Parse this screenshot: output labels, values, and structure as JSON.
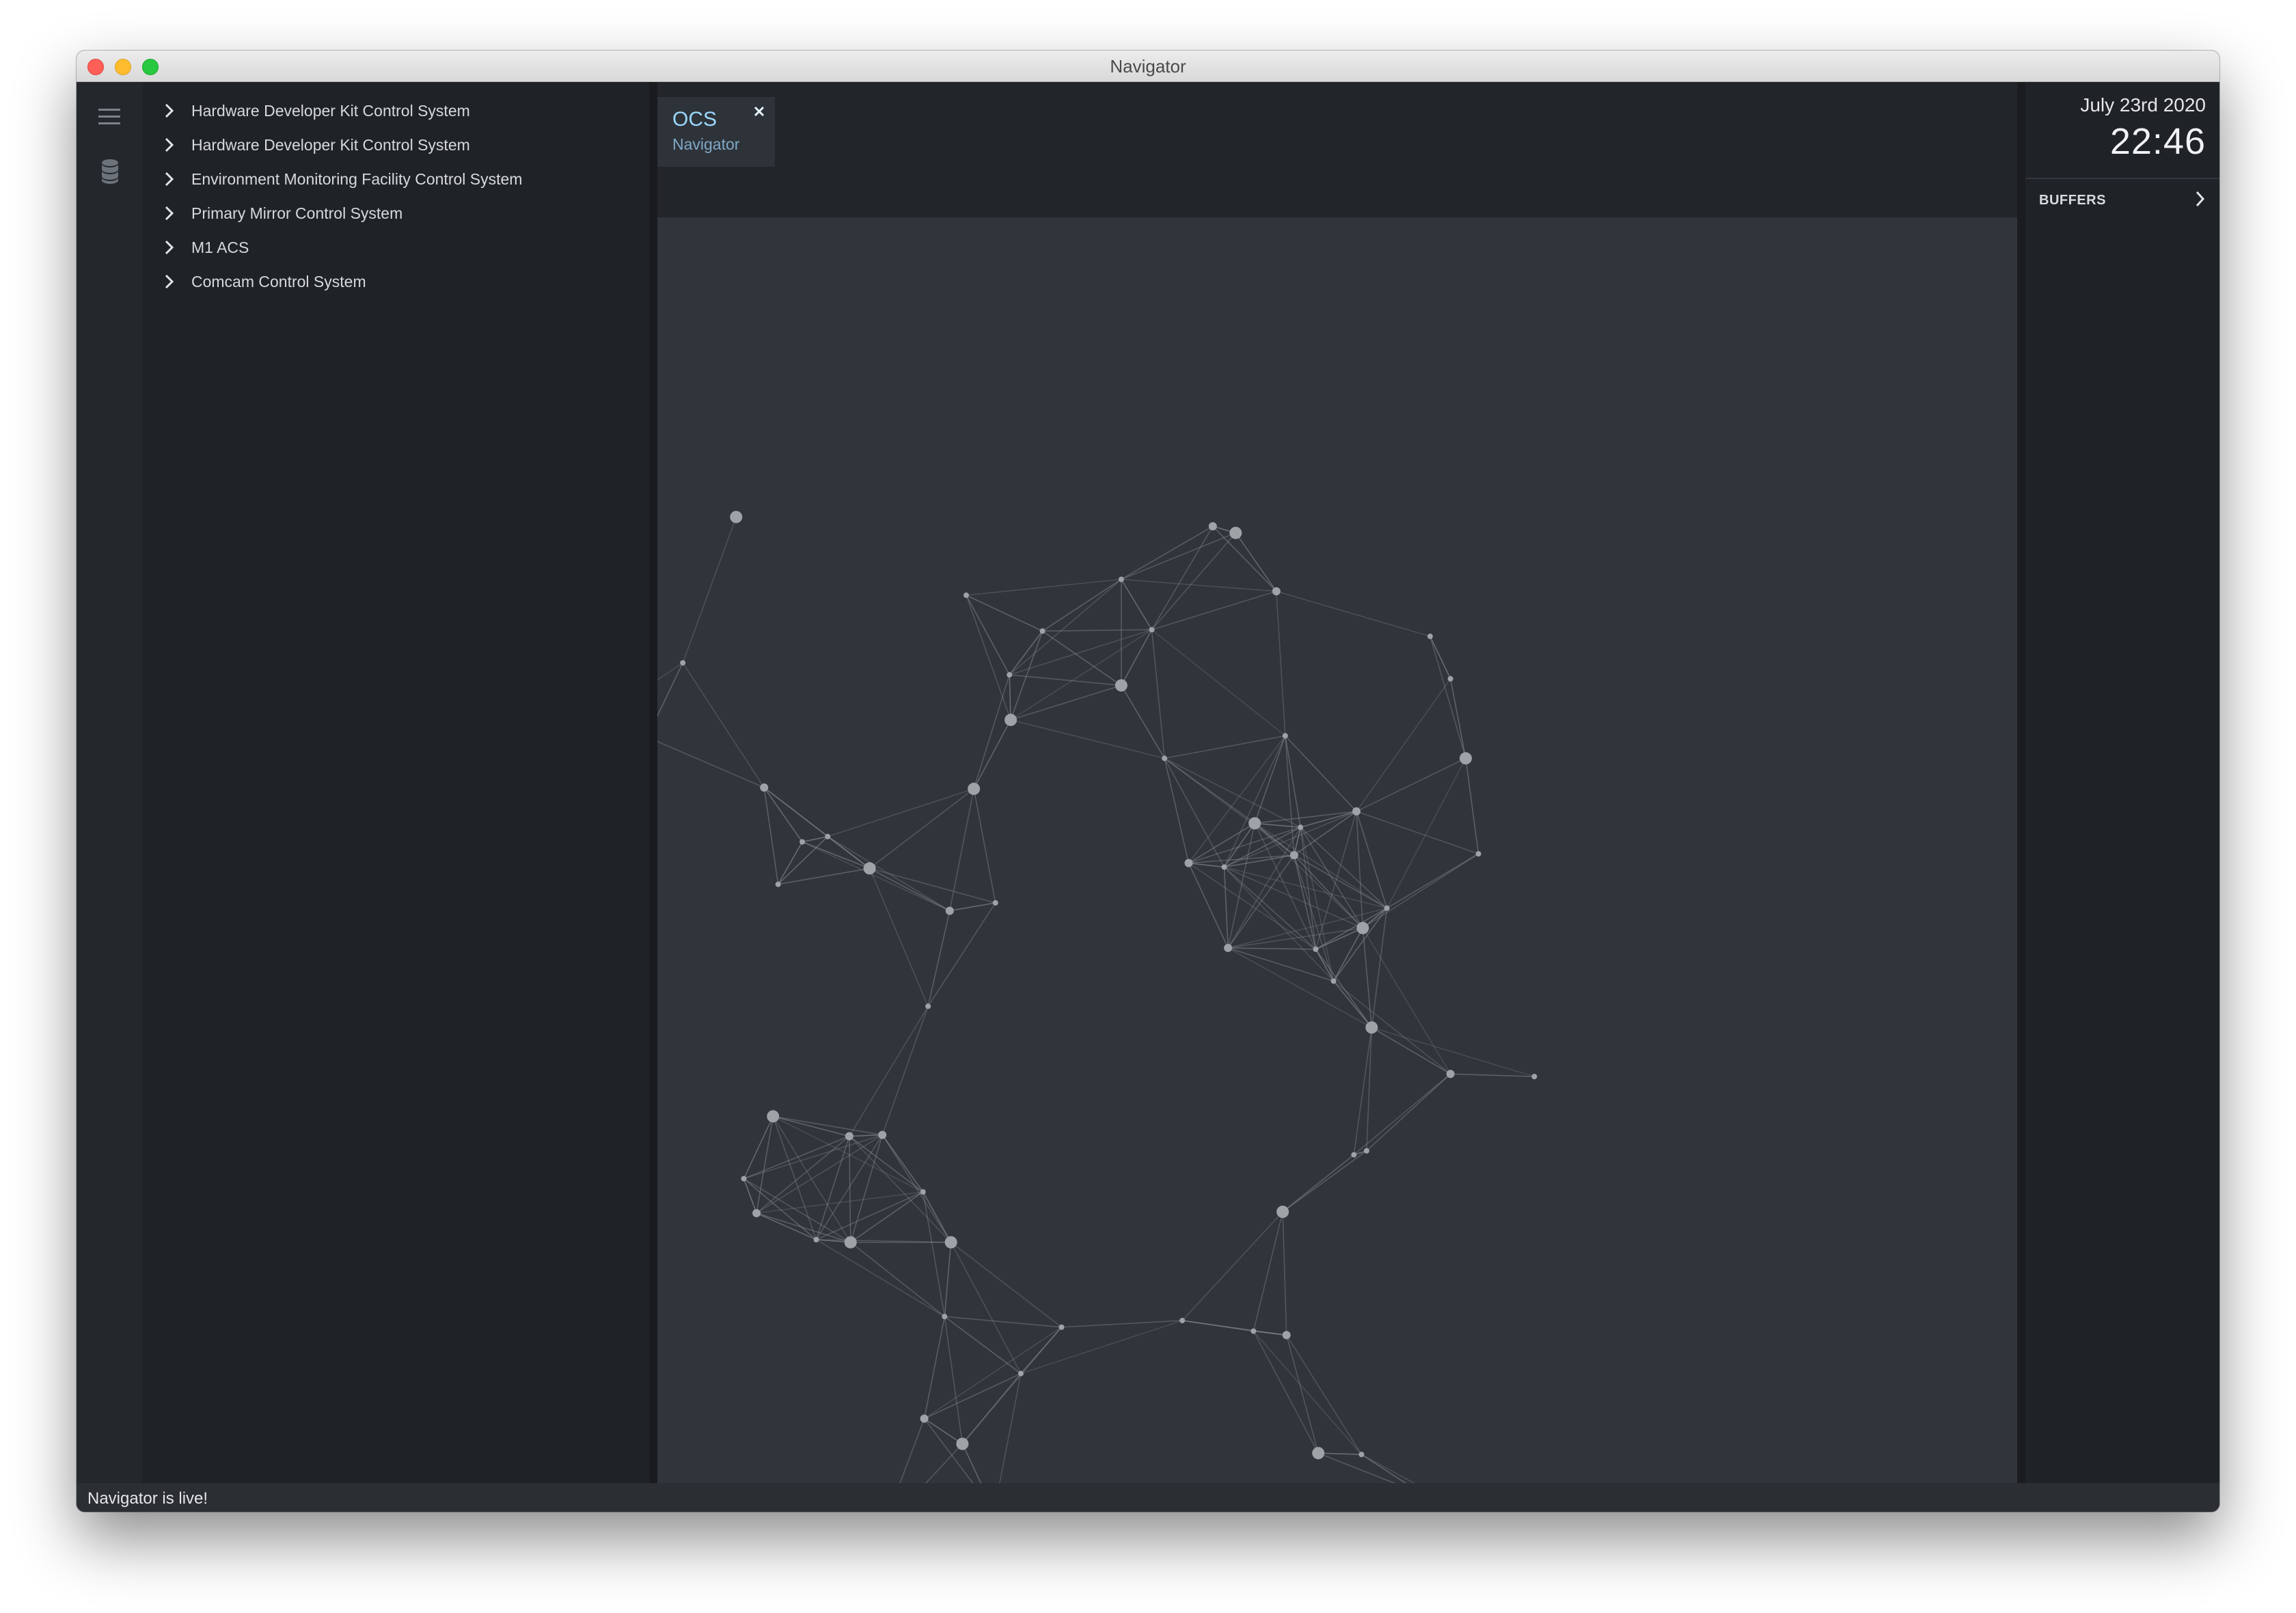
{
  "window": {
    "title": "Navigator"
  },
  "sidebar": {
    "items": [
      {
        "label": "Hardware Developer Kit Control System"
      },
      {
        "label": "Hardware Developer Kit Control System"
      },
      {
        "label": "Environment Monitoring Facility Control System"
      },
      {
        "label": "Primary Mirror Control System"
      },
      {
        "label": "M1 ACS"
      },
      {
        "label": "Comcam Control System"
      }
    ]
  },
  "tab": {
    "title": "OCS",
    "subtitle": "Navigator"
  },
  "clock": {
    "date": "July 23rd 2020",
    "time": "22:46"
  },
  "right_panel": {
    "buffers_label": "BUFFERS"
  },
  "status": {
    "text": "Navigator is live!"
  },
  "colors": {
    "tab_title": "#9bd8ff",
    "canvas_bg": "#30353b",
    "node": "#9fa3a8",
    "edge": "#8a8e94"
  }
}
